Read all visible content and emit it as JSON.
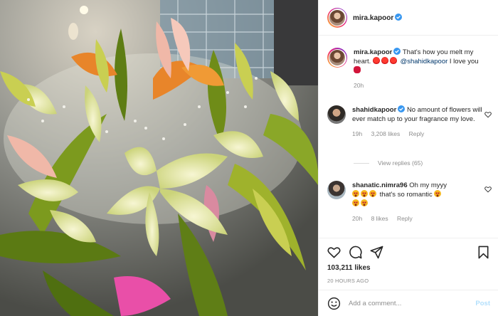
{
  "header": {
    "username": "mira.kapoor",
    "verified": true
  },
  "caption": {
    "username": "mira.kapoor",
    "text_before": "That's how you melt my heart.",
    "mention": "@shahidkapoor",
    "text_after": "I love you",
    "time": "20h",
    "emojis": [
      "red-heart",
      "red-heart",
      "red-heart",
      "kiss-mark"
    ]
  },
  "comments": [
    {
      "username": "shahidkapoor",
      "verified": true,
      "text": "No amount of flowers will ever match up to your fragrance my love.",
      "time": "19h",
      "likes": "3,208 likes",
      "reply": "Reply",
      "view_replies": "View replies (65)"
    },
    {
      "username": "shanatic.nimra96",
      "text_start": "Oh my myyy",
      "text_end": "that's so romantic",
      "time": "20h",
      "likes": "8 likes",
      "reply": "Reply",
      "emojis": [
        "star-struck",
        "star-struck",
        "star-struck",
        "star-struck",
        "star-struck",
        "star-struck"
      ]
    }
  ],
  "actions": {
    "likes": "103,211 likes",
    "timestamp": "20 HOURS AGO",
    "comment_placeholder": "Add a comment...",
    "post_label": "Post"
  },
  "colors": {
    "link": "#00376b",
    "verified": "#3897f0",
    "muted": "#8e8e8e",
    "post_disabled": "#b2dffc"
  },
  "icons": [
    "heart-icon",
    "comment-icon",
    "share-icon",
    "bookmark-icon",
    "smiley-icon",
    "verified-badge-icon"
  ]
}
